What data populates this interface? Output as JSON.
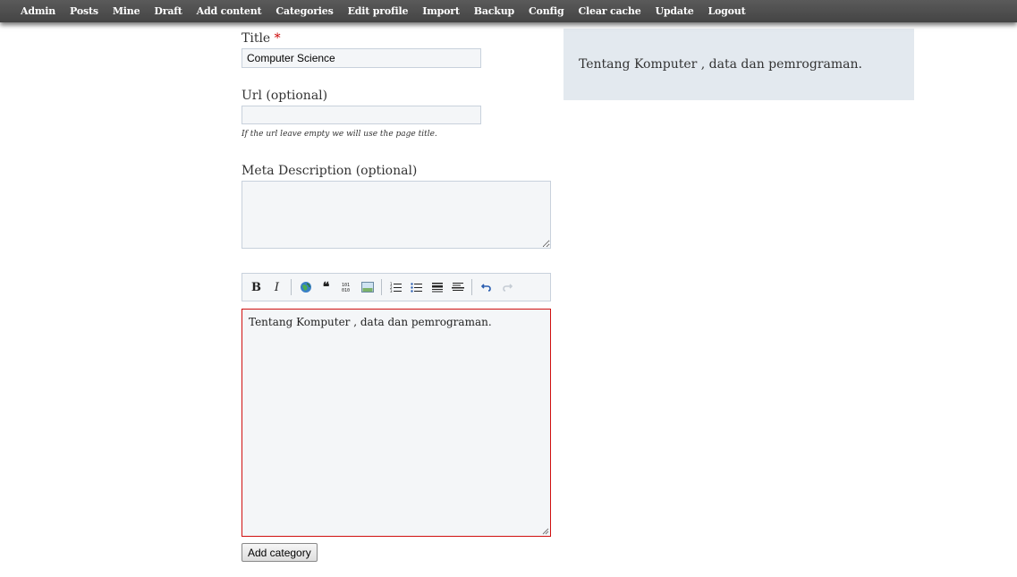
{
  "nav": {
    "items": [
      "Admin",
      "Posts",
      "Mine",
      "Draft",
      "Add content",
      "Categories",
      "Edit profile",
      "Import",
      "Backup",
      "Config",
      "Clear cache",
      "Update",
      "Logout"
    ]
  },
  "form": {
    "title_label": "Title",
    "title_required_mark": "*",
    "title_value": "Computer Science",
    "url_label": "Url (optional)",
    "url_value": "",
    "url_hint": "If the url leave empty we will use the page title.",
    "meta_label": "Meta Description (optional)",
    "meta_value": "",
    "editor_content": "Tentang Komputer , data dan pemrograman.",
    "submit_label": "Add category"
  },
  "toolbar": {
    "bold": "B",
    "italic": "I",
    "quote": "❝"
  },
  "preview": {
    "text": "Tentang Komputer , data dan pemrograman."
  }
}
